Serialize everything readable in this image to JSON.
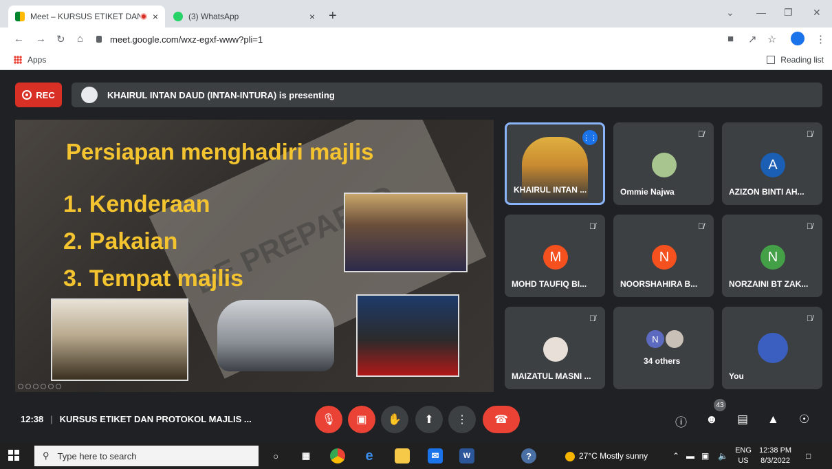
{
  "browser": {
    "tabs": [
      {
        "title": "Meet – KURSUS ETIKET DAN",
        "recording": true,
        "close": "×"
      },
      {
        "title": "(3) WhatsApp",
        "close": "×"
      }
    ],
    "new_tab": "+",
    "url": "meet.google.com/wxz-egxf-www?pli=1",
    "bookmarks": {
      "apps": "Apps",
      "reading_list": "Reading list"
    }
  },
  "meet": {
    "rec_label": "REC",
    "presenting_text": "KHAIRUL INTAN DAUD (INTAN-INTURA) is presenting",
    "slide": {
      "title": "Persiapan menghadiri majlis",
      "items": [
        "1.  Kenderaan",
        "2.  Pakaian",
        "3.  Tempat majlis"
      ],
      "background_text": "BE PREPARED"
    },
    "participants": [
      {
        "name": "KHAIRUL INTAN ...",
        "letter": "",
        "color": "",
        "speaking": true
      },
      {
        "name": "Ommie Najwa",
        "letter": "",
        "color": "#a8c590",
        "muted": true
      },
      {
        "name": "AZIZON BINTI AH...",
        "letter": "A",
        "color": "#1a5fb4",
        "muted": true
      },
      {
        "name": "MOHD TAUFIQ BI...",
        "letter": "M",
        "color": "#f4511e",
        "muted": true
      },
      {
        "name": "NOORSHAHIRA B...",
        "letter": "N",
        "color": "#f4511e",
        "muted": true
      },
      {
        "name": "NORZAINI BT ZAK...",
        "letter": "N",
        "color": "#43a047",
        "muted": true
      },
      {
        "name": "MAIZATUL MASNI ...",
        "letter": "",
        "color": "#e8e0d8",
        "muted": true
      },
      {
        "name": "34 others",
        "letter": "N",
        "color": "#5c6bc0"
      },
      {
        "name": "You",
        "letter": "",
        "color": "#3b5fc0",
        "muted": true
      }
    ],
    "time": "12:38",
    "meeting_title": "KURSUS ETIKET DAN PROTOKOL MAJLIS ...",
    "people_count": "43"
  },
  "taskbar": {
    "search_placeholder": "Type here to search",
    "weather": "27°C  Mostly sunny",
    "lang": "ENG",
    "region": "US",
    "time": "12:38 PM",
    "date": "8/3/2022"
  }
}
